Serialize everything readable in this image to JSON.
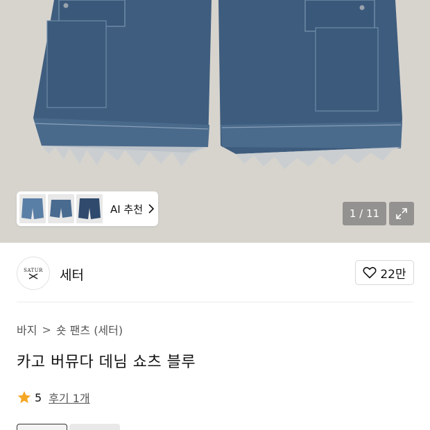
{
  "gallery": {
    "ai_label": "AI 추천",
    "counter": "1 / 11",
    "thumbnails": [
      "denim-shorts-light-thumb",
      "denim-shorts-mid-thumb",
      "denim-shorts-dark-thumb"
    ]
  },
  "brand": {
    "logo_text": "SATUR",
    "name": "세터",
    "likes": "22만"
  },
  "breadcrumb": {
    "category": "바지",
    "separator": ">",
    "subcategory": "숏 팬츠 (세터)"
  },
  "product": {
    "title": "카고 버뮤다 데님 쇼츠 블루",
    "rating": "5",
    "review_text": "후기 1개"
  },
  "colors": {
    "star": "#f5a623",
    "denim": "#3f5d7e",
    "background": "#d6d3cd"
  }
}
